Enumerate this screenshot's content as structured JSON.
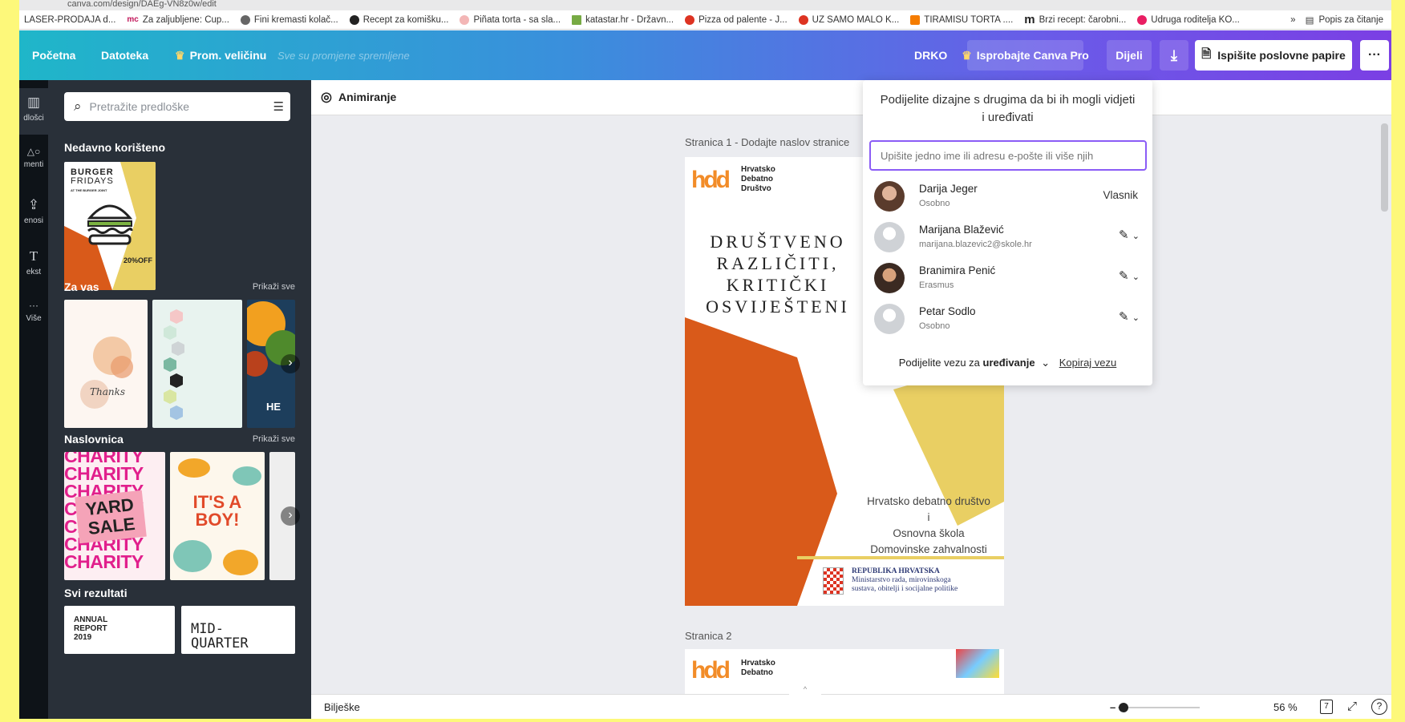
{
  "browser": {
    "url_text": "canva.com/design/DAEg-VN8z0w/edit",
    "bookmarks": [
      {
        "label": "LASER-PRODAJA d...",
        "color": "#444"
      },
      {
        "label": "Za zaljubljene: Cup...",
        "color": "#c2185b",
        "icon": "mc"
      },
      {
        "label": "Fini kremasti kolač...",
        "color": "#666"
      },
      {
        "label": "Recept za komišku...",
        "color": "#222"
      },
      {
        "label": "Piñata torta - sa sla...",
        "color": "#e88"
      },
      {
        "label": "katastar.hr - Državn...",
        "color": "#7a4"
      },
      {
        "label": "Pizza od palente - J...",
        "color": "#d32"
      },
      {
        "label": "UZ SAMO MALO K...",
        "color": "#d32"
      },
      {
        "label": "TIRAMISU TORTA ....",
        "color": "#f57c00"
      },
      {
        "label": "Brzi recept: čarobni...",
        "color": "#222",
        "icon": "m"
      },
      {
        "label": "Udruga roditelja KO...",
        "color": "#e91e63"
      }
    ],
    "more": "»",
    "reading_list": "Popis za čitanje"
  },
  "topbar": {
    "home": "Početna",
    "file": "Datoteka",
    "resize": "Prom. veličinu",
    "saved_status": "Sve su promjene spremljene",
    "doc_name": "DRKO",
    "try_pro": "Isprobajte Canva Pro",
    "share": "Dijeli",
    "print": "Ispišite poslovne papire",
    "more": "···"
  },
  "rail": [
    {
      "label": "dlošci",
      "icon": "▥"
    },
    {
      "label": "menti",
      "icon": "△○"
    },
    {
      "label": "enosi",
      "icon": "⇪"
    },
    {
      "label": "ekst",
      "icon": "T"
    },
    {
      "label": "Više",
      "icon": "···"
    }
  ],
  "panel": {
    "search_placeholder": "Pretražite predloške",
    "recent_title": "Nedavno korišteno",
    "for_you_title": "Za vas",
    "cover_title": "Naslovnica",
    "all_results_title": "Svi rezultati",
    "show_all": "Prikaži sve",
    "recent_thumb": {
      "line1": "BURGER",
      "line2": "FRIDAYS",
      "line3": "AT THE BURGER JOINT",
      "discount": "20%OFF"
    },
    "for_you_thumb1": "Thanks",
    "for_you_thumb3": "HE",
    "cover_thumb1_lines": [
      "CHARITY",
      "CHARITY",
      "CHARITY",
      "CHARITY",
      "CHARITY",
      "CHARITY",
      "CHARITY"
    ],
    "cover_thumb1_badge": [
      "YARD",
      "SALE"
    ],
    "cover_thumb2": [
      "IT'S A",
      "BOY!"
    ],
    "results_thumb1": [
      "ANNUAL",
      "REPORT",
      "2019"
    ],
    "results_thumb2": [
      "MID-",
      "QUARTER"
    ]
  },
  "canvas": {
    "animate": "Animiranje",
    "page1_label": "Stranica 1 - Dodajte naslov stranice",
    "page2_label": "Stranica 2",
    "logo_text": [
      "Hrvatsko",
      "Debatno",
      "Društvo"
    ],
    "logo_mark": "hdd",
    "headline": [
      "DRUŠTVENO",
      "RAZLIČITI,",
      "KRITIČKI",
      "OSVIJEŠTENI"
    ],
    "footer_lines": [
      "Hrvatsko debatno društvo",
      "i",
      "Osnovna škola",
      "Domovinske zahvalnosti"
    ],
    "ministry": [
      "REPUBLIKA HRVATSKA",
      "Ministarstvo rada, mirovinskoga",
      "sustava, obitelji i socijalne politike"
    ],
    "notes": "Bilješke",
    "zoom": "56 %",
    "page_count": "7"
  },
  "share_popup": {
    "title": "Podijelite dizajne s drugima da bi ih mogli vidjeti i uređivati",
    "input_placeholder": "Upišite jedno ime ili adresu e-pošte ili više njih",
    "people": [
      {
        "name": "Darija Jeger",
        "sub": "Osobno",
        "role": "Vlasnik"
      },
      {
        "name": "Marijana Blažević",
        "sub": "marijana.blazevic2@skole.hr",
        "role": "edit"
      },
      {
        "name": "Branimira Penić",
        "sub": "Erasmus",
        "role": "edit"
      },
      {
        "name": "Petar Sodlo",
        "sub": "Osobno",
        "role": "edit"
      }
    ],
    "link_prefix": "Podijelite vezu za",
    "link_mode": "uređivanje",
    "copy_link": "Kopiraj vezu"
  },
  "colors": {
    "frame": "#fdf87a",
    "accent": "#8b5cf6",
    "orange": "#d95a1a",
    "yellow": "#e9cf63",
    "panel": "#293039"
  }
}
